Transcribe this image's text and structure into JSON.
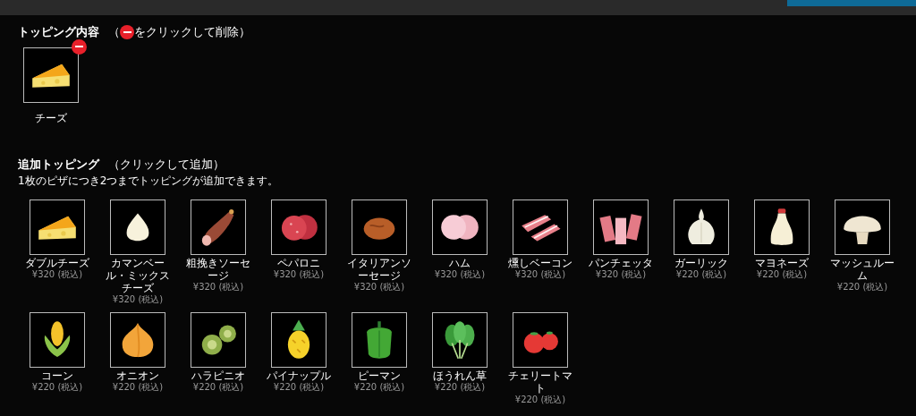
{
  "current": {
    "title": "トッピング内容",
    "hint_open": "（",
    "hint_close": "をクリックして削除）",
    "items": [
      {
        "name": "チーズ"
      }
    ]
  },
  "extra": {
    "title": "追加トッピング",
    "hint": "（クリックして追加）",
    "note": "1枚のピザにつき2つまでトッピングが追加できます。",
    "items": [
      {
        "name": "ダブルチーズ",
        "price": "¥320 (税込)"
      },
      {
        "name": "カマンベール・ミックスチーズ",
        "price": "¥320 (税込)"
      },
      {
        "name": "粗挽きソーセージ",
        "price": "¥320 (税込)"
      },
      {
        "name": "ペパロニ",
        "price": "¥320 (税込)"
      },
      {
        "name": "イタリアンソーセージ",
        "price": "¥320 (税込)"
      },
      {
        "name": "ハム",
        "price": "¥320 (税込)"
      },
      {
        "name": "燻しベーコン",
        "price": "¥320 (税込)"
      },
      {
        "name": "パンチェッタ",
        "price": "¥320 (税込)"
      },
      {
        "name": "ガーリック",
        "price": "¥220 (税込)"
      },
      {
        "name": "マヨネーズ",
        "price": "¥220 (税込)"
      },
      {
        "name": "マッシュルーム",
        "price": "¥220 (税込)"
      },
      {
        "name": "コーン",
        "price": "¥220 (税込)"
      },
      {
        "name": "オニオン",
        "price": "¥220 (税込)"
      },
      {
        "name": "ハラピニオ",
        "price": "¥220 (税込)"
      },
      {
        "name": "パイナップル",
        "price": "¥220 (税込)"
      },
      {
        "name": "ピーマン",
        "price": "¥220 (税込)"
      },
      {
        "name": "ほうれん草",
        "price": "¥220 (税込)"
      },
      {
        "name": "チェリートマト",
        "price": "¥220 (税込)"
      }
    ]
  }
}
